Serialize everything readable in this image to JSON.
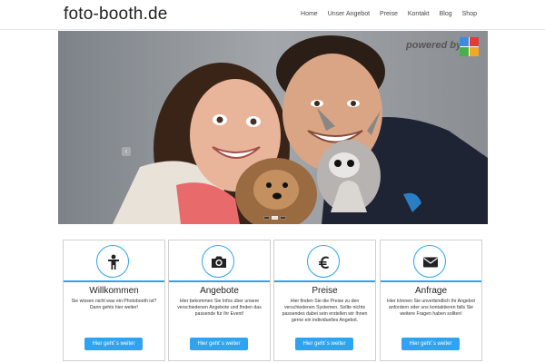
{
  "header": {
    "logo": "foto-booth.de",
    "nav": [
      "Home",
      "Unser Angebot",
      "Preise",
      "Kontakt",
      "Blog",
      "Shop"
    ]
  },
  "slider": {
    "powered_text": "powered by",
    "prev_glyph": "‹",
    "next_glyph": "›",
    "slide_count": 3,
    "active_slide": 1
  },
  "cards": [
    {
      "icon": "person-icon",
      "title": "Willkommen",
      "text": "Sie wissen nicht was ein Photobooth ist? Dann gehts hier weiter!",
      "button": "Hier geht´s weiter"
    },
    {
      "icon": "camera-icon",
      "title": "Angebote",
      "text": "Hier bekommen Sie Infos über unsere verschiedenen Angebote und finden das passende für Ihr Event!",
      "button": "Hier geht´s weiter"
    },
    {
      "icon": "euro-icon",
      "title": "Preise",
      "text": "Hier finden Sie die Preise zu den verschiedenen Systemen. Sollte nichts passendes dabei sein erstellen wir Ihnen gerne ein individuelles Angebot.",
      "button": "Hier geht´s weiter"
    },
    {
      "icon": "envelope-icon",
      "title": "Anfrage",
      "text": "Hier können Sie unverbindlich Ihr Angebot anfordern oder uns kontaktieren falls Sie weitere Fragen haben sollten!",
      "button": "Hier geht´s weiter"
    }
  ],
  "colors": {
    "accent": "#2ea3f2",
    "card_border": "#cfcfcf",
    "header_border": "#e6e6e6"
  }
}
